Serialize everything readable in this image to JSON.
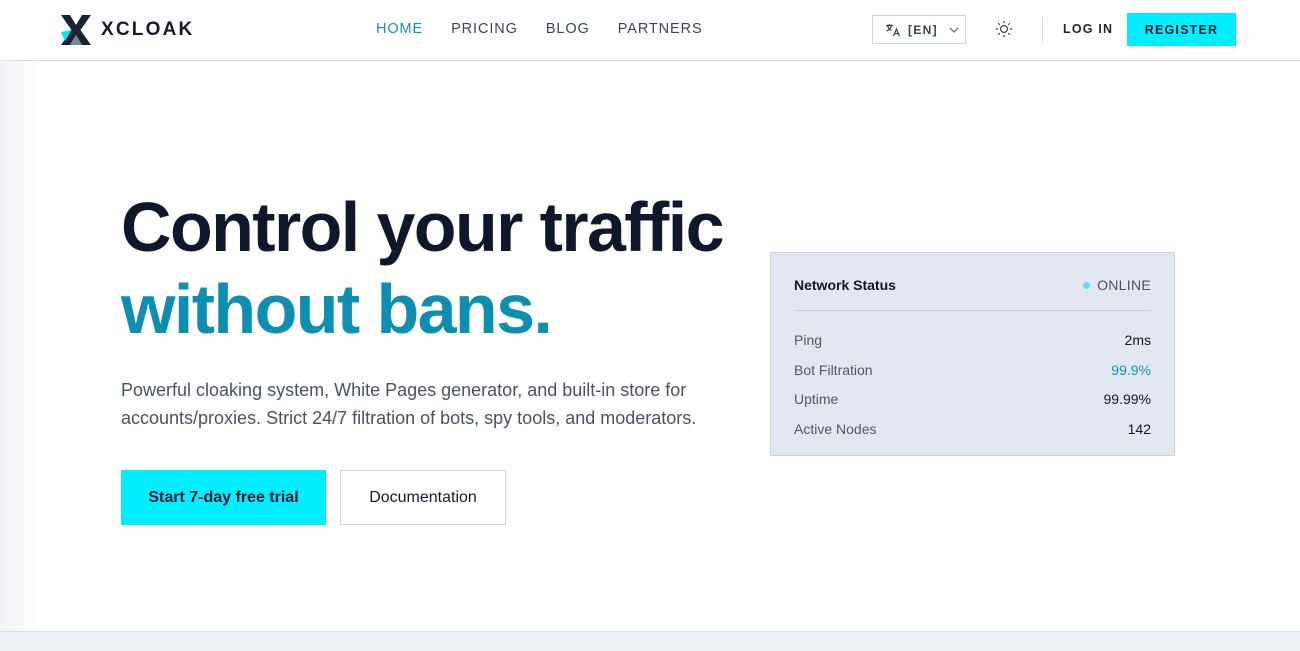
{
  "header": {
    "brand": "XCLOAK",
    "nav": [
      {
        "label": "HOME",
        "active": true
      },
      {
        "label": "PRICING",
        "active": false
      },
      {
        "label": "BLOG",
        "active": false
      },
      {
        "label": "PARTNERS",
        "active": false
      }
    ],
    "language_label": "[EN]",
    "language_icon": "translate-icon",
    "theme_icon": "sun-icon",
    "login_label": "LOG IN",
    "register_label": "REGISTER"
  },
  "hero": {
    "title_line1": "Control your traffic",
    "title_line2": "without bans.",
    "description": "Powerful cloaking system, White Pages generator, and built-in store for accounts/proxies. Strict 24/7 filtration of bots, spy tools, and moderators.",
    "primary_cta": "Start 7-day free trial",
    "secondary_cta": "Documentation"
  },
  "status": {
    "title": "Network Status",
    "state": "ONLINE",
    "rows": [
      {
        "label": "Ping",
        "value": "2ms"
      },
      {
        "label": "Bot Filtration",
        "value": "99.9%"
      },
      {
        "label": "Uptime",
        "value": "99.99%"
      },
      {
        "label": "Active Nodes",
        "value": "142"
      }
    ]
  },
  "colors": {
    "accent_cyan": "#00eeff",
    "accent_teal": "#0e8fb1",
    "text_dark": "#0f172a",
    "card_bg": "#e2e8f0",
    "online_dot": "#62dcf0"
  }
}
